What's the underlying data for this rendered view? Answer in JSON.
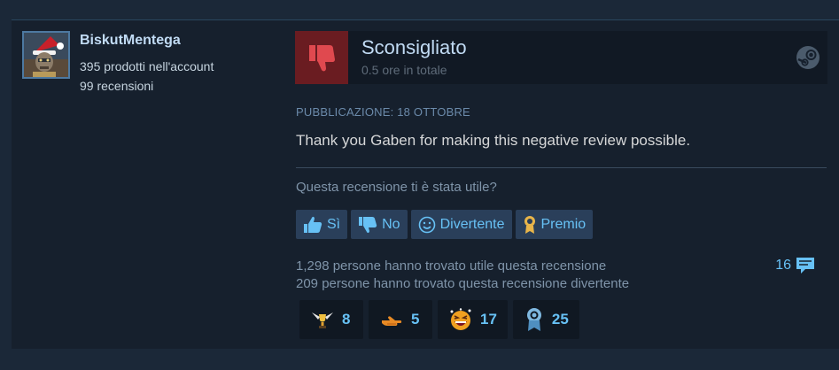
{
  "author": {
    "name": "BiskutMentega",
    "products": "395 prodotti nell'account",
    "reviews": "99 recensioni"
  },
  "review": {
    "recommendation": "Sconsigliato",
    "hours": "0.5 ore in totale",
    "posted": "PUBBLICAZIONE: 18 OTTOBRE",
    "content": "Thank you Gaben for making this negative review possible."
  },
  "feedback": {
    "question": "Questa recensione ti è stata utile?",
    "yes_label": "Sì",
    "no_label": "No",
    "funny_label": "Divertente",
    "award_label": "Premio",
    "helpful_text": "1,298 persone hanno trovato utile questa recensione",
    "funny_text": "209 persone hanno trovato questa recensione divertente",
    "comment_count": "16"
  },
  "awards": [
    {
      "icon": "winged-trophy-icon",
      "count": "8"
    },
    {
      "icon": "pointing-hand-icon",
      "count": "5"
    },
    {
      "icon": "laughing-face-icon",
      "count": "17"
    },
    {
      "icon": "ribbon-medal-icon",
      "count": "25"
    }
  ],
  "colors": {
    "background": "#1b2838",
    "card": "#16202d",
    "accent": "#67c1f5",
    "thumb_down_bg": "#6a1c21",
    "thumb_down": "#e0494f"
  }
}
